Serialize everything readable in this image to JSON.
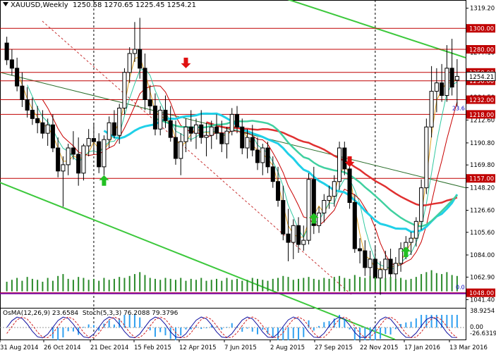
{
  "window": {
    "symbol": "XAUUSD,Weekly",
    "ohlc": "1250.58 1270.65 1225.45 1254.21"
  },
  "osma": {
    "label": "OsMA(12,26,9) 23.6584",
    "stoch": "Stoch(5,3,3) 76.2088 79.3796"
  },
  "chart_data": {
    "type": "candlestick",
    "price_axis": {
      "ticks": [
        "1319.20",
        "1298.40",
        "1277.10",
        "1256.30",
        "1234.50",
        "1212.60",
        "1190.80",
        "1169.80",
        "1148.20",
        "1126.60",
        "1105.60",
        "1084.00",
        "1062.90",
        "1041.40"
      ],
      "ylim": [
        1037.0,
        1327.0
      ]
    },
    "x_labels": [
      "31 Aug 2014",
      "26 Oct 2014",
      "21 Dec 2014",
      "15 Feb 2015",
      "12 Apr 2015",
      "7 Jun 2015",
      "2 Aug 2015",
      "27 Sep 2015",
      "22 Nov 2015",
      "17 Jan 2016",
      "13 Mar 2016"
    ],
    "levels": [
      {
        "label": "1300.00",
        "value": 1300.0
      },
      {
        "label": "1280.00",
        "value": 1280.0
      },
      {
        "label": "1258.00",
        "value": 1258.0
      },
      {
        "label": "1250.00",
        "value": 1250.0
      },
      {
        "label": "1232.00",
        "value": 1232.0
      },
      {
        "label": "1218.00",
        "value": 1218.0
      },
      {
        "label": "1157.00",
        "value": 1157.0
      },
      {
        "label": "1048.00",
        "value": 1048.0
      }
    ],
    "current_price": "1254.21",
    "annotation": "23.6",
    "volume_zero_label": "0.0",
    "osma_axis": [
      "38.9254",
      "0.00",
      "-26.6319"
    ],
    "candles": [
      [
        1286,
        1292,
        1265,
        1270
      ],
      [
        1270,
        1280,
        1255,
        1262
      ],
      [
        1262,
        1272,
        1240,
        1245
      ],
      [
        1245,
        1258,
        1225,
        1232
      ],
      [
        1232,
        1244,
        1215,
        1222
      ],
      [
        1222,
        1234,
        1208,
        1214
      ],
      [
        1214,
        1226,
        1200,
        1210
      ],
      [
        1210,
        1222,
        1195,
        1200
      ],
      [
        1200,
        1214,
        1188,
        1208
      ],
      [
        1208,
        1218,
        1182,
        1186
      ],
      [
        1186,
        1196,
        1158,
        1164
      ],
      [
        1164,
        1178,
        1130,
        1170
      ],
      [
        1170,
        1190,
        1160,
        1186
      ],
      [
        1186,
        1202,
        1175,
        1180
      ],
      [
        1180,
        1196,
        1150,
        1162
      ],
      [
        1162,
        1190,
        1155,
        1188
      ],
      [
        1188,
        1204,
        1178,
        1195
      ],
      [
        1195,
        1210,
        1180,
        1192
      ],
      [
        1192,
        1200,
        1162,
        1168
      ],
      [
        1168,
        1198,
        1160,
        1194
      ],
      [
        1194,
        1216,
        1186,
        1210
      ],
      [
        1210,
        1222,
        1195,
        1198
      ],
      [
        1198,
        1228,
        1190,
        1224
      ],
      [
        1224,
        1262,
        1218,
        1258
      ],
      [
        1258,
        1282,
        1248,
        1276
      ],
      [
        1276,
        1306,
        1268,
        1280
      ],
      [
        1280,
        1310,
        1252,
        1262
      ],
      [
        1262,
        1276,
        1222,
        1232
      ],
      [
        1232,
        1246,
        1218,
        1226
      ],
      [
        1226,
        1238,
        1198,
        1204
      ],
      [
        1204,
        1226,
        1198,
        1222
      ],
      [
        1222,
        1236,
        1205,
        1212
      ],
      [
        1212,
        1226,
        1192,
        1196
      ],
      [
        1196,
        1212,
        1170,
        1176
      ],
      [
        1176,
        1200,
        1160,
        1192
      ],
      [
        1192,
        1214,
        1182,
        1206
      ],
      [
        1206,
        1222,
        1192,
        1200
      ],
      [
        1200,
        1214,
        1185,
        1208
      ],
      [
        1208,
        1222,
        1190,
        1196
      ],
      [
        1196,
        1210,
        1178,
        1198
      ],
      [
        1198,
        1212,
        1185,
        1206
      ],
      [
        1206,
        1218,
        1194,
        1200
      ],
      [
        1200,
        1212,
        1182,
        1190
      ],
      [
        1190,
        1206,
        1176,
        1202
      ],
      [
        1202,
        1224,
        1198,
        1218
      ],
      [
        1218,
        1226,
        1200,
        1206
      ],
      [
        1206,
        1214,
        1180,
        1186
      ],
      [
        1186,
        1204,
        1176,
        1196
      ],
      [
        1196,
        1208,
        1178,
        1184
      ],
      [
        1184,
        1196,
        1165,
        1172
      ],
      [
        1172,
        1190,
        1160,
        1186
      ],
      [
        1186,
        1192,
        1162,
        1168
      ],
      [
        1168,
        1178,
        1148,
        1154
      ],
      [
        1154,
        1168,
        1130,
        1136
      ],
      [
        1136,
        1150,
        1098,
        1104
      ],
      [
        1104,
        1128,
        1078,
        1096
      ],
      [
        1096,
        1118,
        1080,
        1112
      ],
      [
        1112,
        1120,
        1086,
        1094
      ],
      [
        1094,
        1112,
        1088,
        1098
      ],
      [
        1098,
        1162,
        1094,
        1156
      ],
      [
        1156,
        1168,
        1104,
        1112
      ],
      [
        1112,
        1130,
        1105,
        1124
      ],
      [
        1124,
        1142,
        1115,
        1136
      ],
      [
        1136,
        1150,
        1128,
        1140
      ],
      [
        1140,
        1160,
        1130,
        1154
      ],
      [
        1154,
        1192,
        1146,
        1186
      ],
      [
        1186,
        1192,
        1160,
        1166
      ],
      [
        1166,
        1178,
        1128,
        1134
      ],
      [
        1134,
        1142,
        1086,
        1090
      ],
      [
        1090,
        1100,
        1076,
        1088
      ],
      [
        1088,
        1098,
        1064,
        1072
      ],
      [
        1072,
        1088,
        1052,
        1080
      ],
      [
        1080,
        1092,
        1054,
        1062
      ],
      [
        1062,
        1078,
        1046,
        1070
      ],
      [
        1070,
        1088,
        1058,
        1080
      ],
      [
        1080,
        1090,
        1060,
        1066
      ],
      [
        1066,
        1082,
        1058,
        1076
      ],
      [
        1076,
        1096,
        1068,
        1090
      ],
      [
        1090,
        1102,
        1080,
        1096
      ],
      [
        1096,
        1106,
        1084,
        1100
      ],
      [
        1100,
        1120,
        1092,
        1116
      ],
      [
        1116,
        1156,
        1108,
        1148
      ],
      [
        1148,
        1214,
        1142,
        1206
      ],
      [
        1206,
        1264,
        1196,
        1240
      ],
      [
        1240,
        1262,
        1220,
        1248
      ],
      [
        1248,
        1266,
        1230,
        1236
      ],
      [
        1236,
        1284,
        1230,
        1262
      ],
      [
        1262,
        1290,
        1236,
        1244
      ],
      [
        1250.58,
        1270.65,
        1225.45,
        1254.21
      ]
    ],
    "volume": [
      10,
      12,
      14,
      11,
      15,
      13,
      12,
      10,
      14,
      11,
      16,
      18,
      13,
      12,
      15,
      14,
      12,
      13,
      11,
      14,
      12,
      13,
      15,
      14,
      16,
      18,
      20,
      17,
      14,
      13,
      12,
      14,
      13,
      12,
      14,
      11,
      13,
      12,
      14,
      11,
      12,
      13,
      11,
      14,
      12,
      13,
      11,
      12,
      14,
      13,
      12,
      11,
      13,
      14,
      16,
      15,
      12,
      13,
      14,
      15,
      13,
      12,
      14,
      13,
      15,
      16,
      14,
      13,
      17,
      15,
      14,
      16,
      15,
      13,
      14,
      15,
      13,
      14,
      12,
      13,
      15,
      18,
      20,
      22,
      19,
      18,
      20,
      17,
      16
    ]
  }
}
